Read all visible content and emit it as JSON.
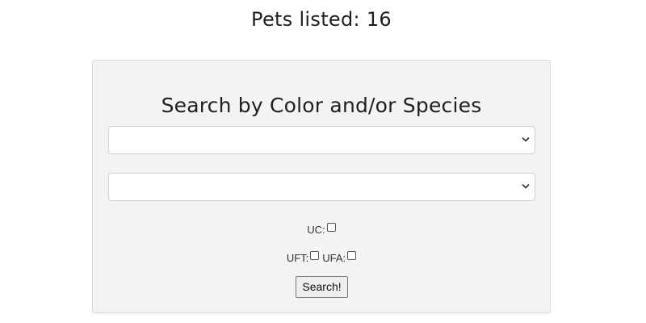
{
  "header": {
    "title": "Pets listed: 16"
  },
  "search_panel": {
    "title": "Search by Color and/or Species",
    "color_select": {
      "selected": ""
    },
    "species_select": {
      "selected": ""
    },
    "uc_label": "UC:",
    "uft_label": "UFT:",
    "ufa_label": "UFA:",
    "uc_checked": false,
    "uft_checked": false,
    "ufa_checked": false,
    "search_button_label": "Search!"
  },
  "icons": {
    "select_arrow": "chevron-down-icon"
  }
}
